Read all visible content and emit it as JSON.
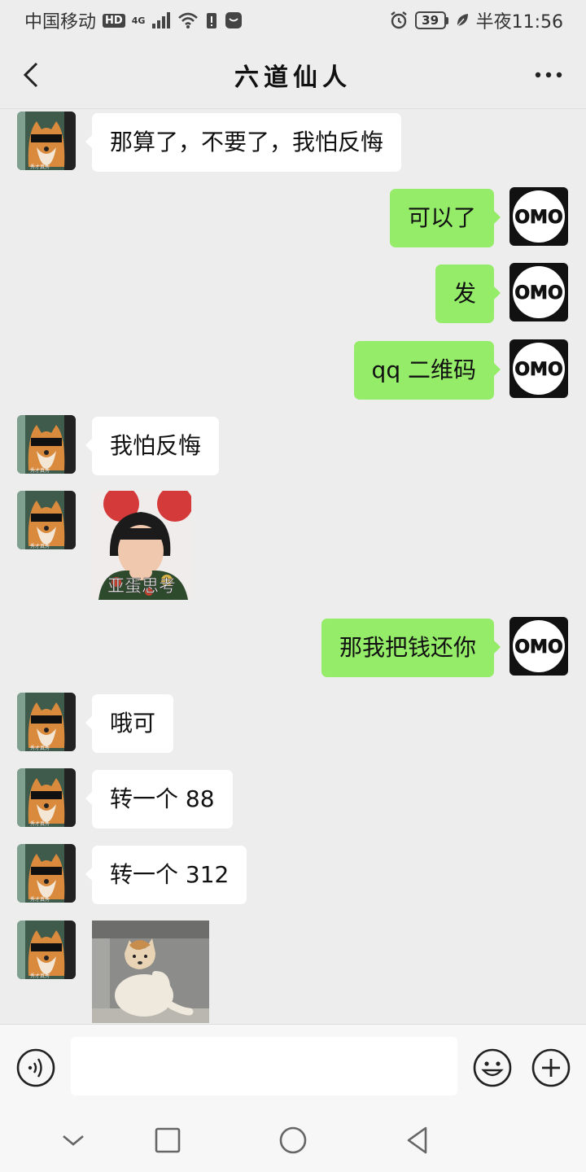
{
  "status_bar": {
    "carrier": "中国移动",
    "hd": "HD",
    "network": "4G",
    "battery": "39",
    "time": "半夜11:56"
  },
  "chat": {
    "title": "六道仙人"
  },
  "avatars": {
    "left_caption": "秀才真秀",
    "right_logo": "OMO"
  },
  "messages": [
    {
      "side": "left",
      "type": "text",
      "text": "那算了，不要了，我怕反悔"
    },
    {
      "side": "right",
      "type": "text",
      "text": "可以了"
    },
    {
      "side": "right",
      "type": "text",
      "text": "发"
    },
    {
      "side": "right",
      "type": "text",
      "text": "qq 二维码"
    },
    {
      "side": "left",
      "type": "text",
      "text": "我怕反悔"
    },
    {
      "side": "left",
      "type": "sticker",
      "caption": "亚蛋思考"
    },
    {
      "side": "right",
      "type": "text",
      "text": "那我把钱还你"
    },
    {
      "side": "left",
      "type": "text",
      "text": "哦可"
    },
    {
      "side": "left",
      "type": "text",
      "text": "转一个 88"
    },
    {
      "side": "left",
      "type": "text",
      "text": "转一个 312"
    },
    {
      "side": "left",
      "type": "sticker",
      "caption": ""
    }
  ],
  "colors": {
    "background": "#ededed",
    "bubble_self": "#95ec69",
    "bubble_other": "#ffffff"
  },
  "icons": {
    "back": "chevron-left-icon",
    "more": "more-dots-icon",
    "voice": "voice-icon",
    "emoji": "emoji-icon",
    "plus": "plus-icon",
    "nav_down": "chevron-down-icon",
    "nav_recent": "square-icon",
    "nav_home": "circle-icon",
    "nav_back": "triangle-back-icon"
  }
}
